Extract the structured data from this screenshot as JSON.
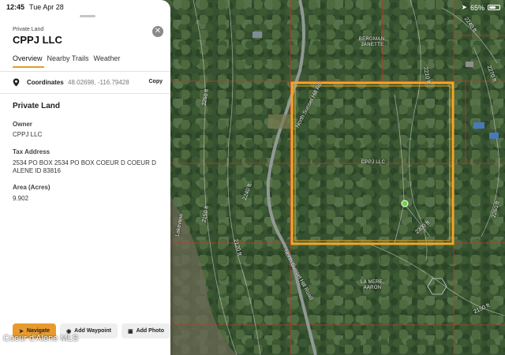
{
  "status": {
    "time": "12:45",
    "date": "Tue Apr 28",
    "battery": "65%"
  },
  "panel": {
    "subtitle": "Private Land",
    "title": "CPPJ LLC",
    "tabs": [
      {
        "label": "Overview",
        "active": true
      },
      {
        "label": "Nearby Trails",
        "active": false
      },
      {
        "label": "Weather",
        "active": false
      }
    ],
    "coordinates": {
      "label": "Coordinates",
      "value": "48.02698, -116.79428",
      "copy_label": "Copy"
    },
    "section_title": "Private Land",
    "fields": [
      {
        "label": "Owner",
        "value": "CPPJ LLC"
      },
      {
        "label": "Tax Address",
        "value": "2534 PO BOX 2534 PO BOX COEUR D COEUR D ALENE ID 83816"
      },
      {
        "label": "Area (Acres)",
        "value": "9.902"
      }
    ],
    "footer": {
      "navigate": "Navigate",
      "add_waypoint": "Add Waypoint",
      "add_photo": "Add Photo"
    }
  },
  "map": {
    "parcel_labels": [
      {
        "text": "BERGMAN, JANETTE"
      },
      {
        "text": "CPPJ LLC"
      },
      {
        "text": "LA MERE, AARON"
      }
    ],
    "road_labels": [
      "North Sunset Hill Rd",
      "North Sunset Hill Road",
      "Lakeview"
    ],
    "contour_labels": [
      "2250 ft",
      "2240 ft",
      "2150 ft",
      "2120 ft",
      "2210 ft",
      "2300 ft",
      "2270 ft",
      "2260 ft",
      "2150 ft",
      "2240 ft"
    ],
    "selection_color": "#f5a623",
    "pin_color": "#6ed14a"
  },
  "watermark": "Coeur d'Alene MLS",
  "icons": {
    "close": "close-icon",
    "coordinates": "location-pin-icon",
    "navigate": "navigation-arrow-icon",
    "waypoint": "waypoint-pin-icon",
    "photo": "camera-icon",
    "battery": "battery-icon",
    "location": "location-arrow-icon"
  }
}
